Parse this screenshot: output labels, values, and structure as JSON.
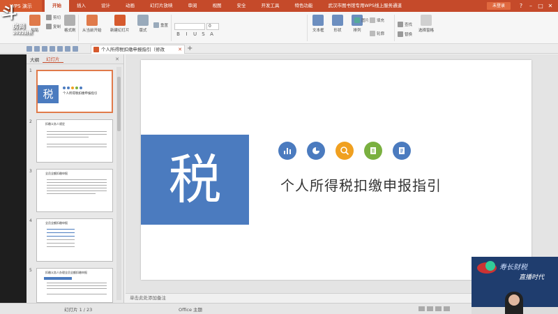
{
  "watermark": {
    "brand": "斗",
    "sub": "房网",
    "year": "2022财税"
  },
  "title_bar": {
    "app_name": "WPS 演示",
    "menu": [
      "开始",
      "插入",
      "设计",
      "动画",
      "幻灯片放映",
      "审阅",
      "视图",
      "安全",
      "开发工具",
      "特色功能",
      "武汉市图书馆专用WPS线上服务通道"
    ],
    "active_menu": "开始",
    "login_label": "未登录"
  },
  "ribbon": {
    "paste": "粘贴",
    "cut": "剪切",
    "copy": "复制",
    "format_painter": "格式刷",
    "from_start": "从当前开始",
    "new_slide": "新建幻灯片",
    "layout": "版式",
    "reset": "重置",
    "font_size": "0",
    "textbox": "文本框",
    "shape": "形状",
    "arrange": "排列",
    "picture": "图片",
    "fill": "填充",
    "outline": "轮廓",
    "find": "查找",
    "replace": "替换",
    "select_pane": "选择窗格"
  },
  "doc_tab": {
    "title": "个人所得税扣缴申报指引（修改版）.pptx"
  },
  "left_panel": {
    "tabs": [
      "大纲",
      "幻灯片"
    ],
    "active_tab": "幻灯片",
    "slides": [
      {
        "num": "1",
        "title": "个人所得税扣缴申报指引"
      },
      {
        "num": "2",
        "title": "扣缴义务人规定"
      },
      {
        "num": "3",
        "title": "全员全额扣缴申报"
      },
      {
        "num": "4",
        "title": "全员全额扣缴申报"
      },
      {
        "num": "5",
        "title": "扣缴义务人办理全员全额扣缴申报"
      }
    ]
  },
  "slide": {
    "big_char": "税",
    "title": "个人所得税扣缴申报指引",
    "icons": [
      {
        "name": "chart-icon",
        "color": "#4b7bbf"
      },
      {
        "name": "pie-icon",
        "color": "#4b7bbf"
      },
      {
        "name": "search-icon",
        "color": "#f0a020"
      },
      {
        "name": "notebook-icon",
        "color": "#7ab040"
      },
      {
        "name": "document-icon",
        "color": "#4b7bbf"
      }
    ]
  },
  "notes_placeholder": "单击此处添加备注",
  "status": {
    "slide_counter": "幻灯片 1 / 23",
    "theme": "Office 主题"
  },
  "video": {
    "line1": "寿长财税",
    "line2": "直播时代"
  },
  "colors": {
    "accent": "#c54a2a",
    "slide_blue": "#4b7bbf"
  }
}
